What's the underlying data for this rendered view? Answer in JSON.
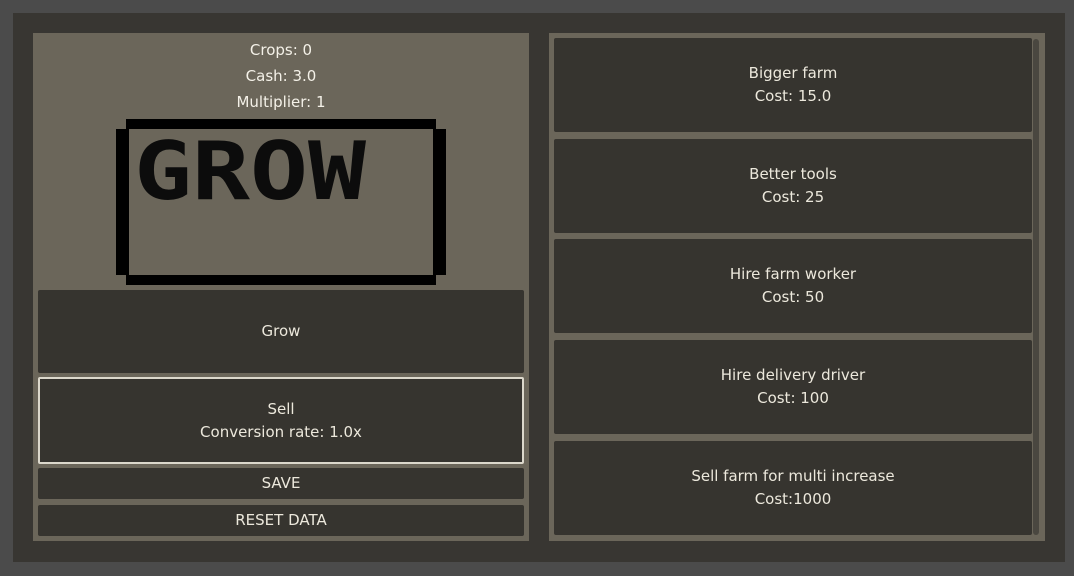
{
  "stats": {
    "crops": "Crops: 0",
    "cash": "Cash: 3.0",
    "multiplier": "Multiplier: 1"
  },
  "sign": {
    "text": "GROW"
  },
  "actions": {
    "grow": "Grow",
    "sell": "Sell",
    "sell_rate": "Conversion rate: 1.0x",
    "save": "SAVE",
    "reset": "RESET DATA"
  },
  "shop": {
    "items": [
      {
        "name": "Bigger farm",
        "cost": "Cost: 15.0"
      },
      {
        "name": "Better tools",
        "cost": "Cost: 25"
      },
      {
        "name": "Hire farm worker",
        "cost": "Cost: 50"
      },
      {
        "name": "Hire delivery driver",
        "cost": "Cost: 100"
      },
      {
        "name": "Sell farm for multi increase",
        "cost": "Cost:1000"
      }
    ]
  },
  "colors": {
    "background": "#4b4b4b",
    "frame": "#383632",
    "panel": "#6b665a",
    "button": "#36342f",
    "text": "#ece8dc",
    "focus_border": "#dcd8cc"
  }
}
